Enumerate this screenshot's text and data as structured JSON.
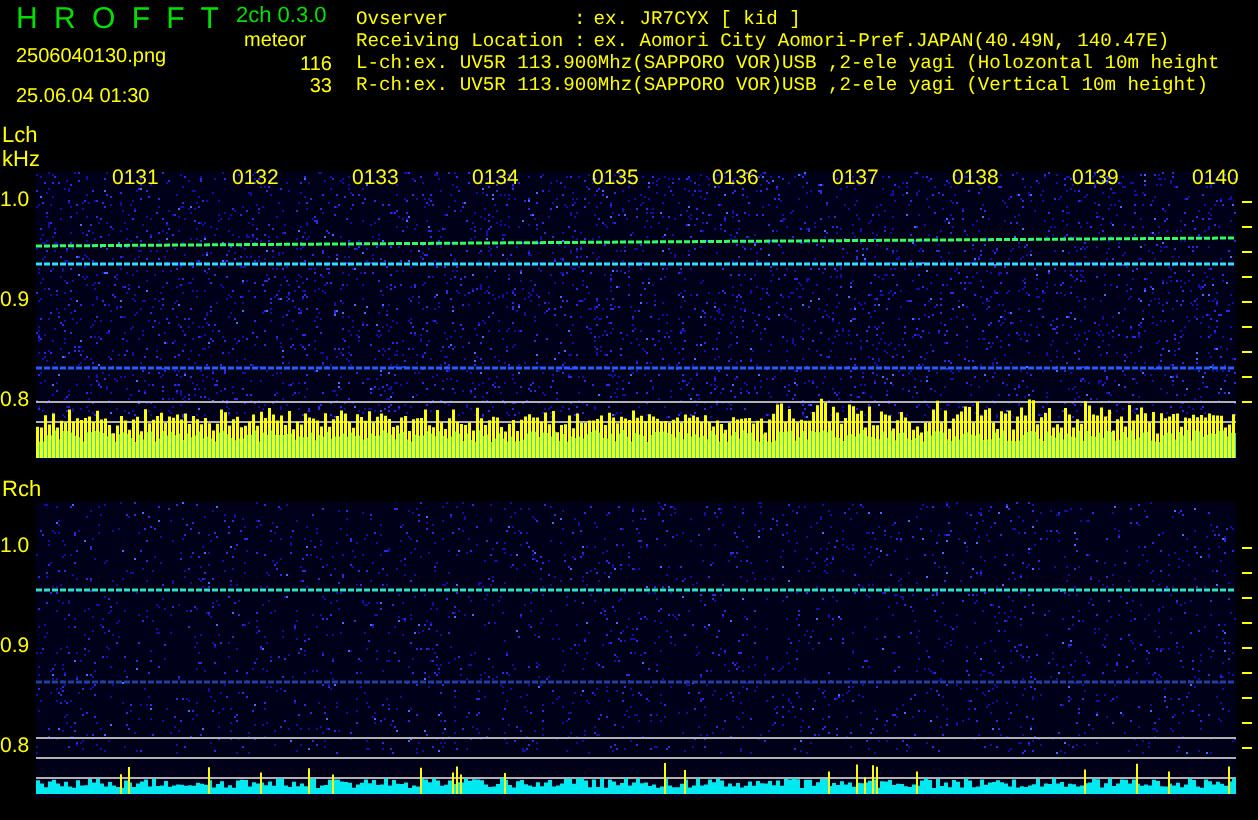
{
  "app": {
    "title": "H R O F F T",
    "version": "2ch 0.3.0",
    "filename": "2506040130.png",
    "datetime": "25.06.04 01:30"
  },
  "meteor": {
    "label": "meteor",
    "counts": [
      "116",
      "33"
    ]
  },
  "info_rows": [
    {
      "kind": "field",
      "label": "Ovserver",
      "separator": ":",
      "value": "ex. JR7CYX [ kid ]"
    },
    {
      "kind": "field",
      "label": "Receiving Location",
      "separator": ":",
      "value": "ex. Aomori City Aomori-Pref.JAPAN(40.49N, 140.47E)"
    },
    {
      "kind": "line",
      "text": "L-ch:ex. UV5R 113.900Mhz(SAPPORO VOR)USB ,2-ele yagi (Holozontal 10m height"
    },
    {
      "kind": "line",
      "text": "R-ch:ex. UV5R 113.900Mhz(SAPPORO VOR)USB ,2-ele yagi (Vertical 10m height)"
    }
  ],
  "panels": [
    {
      "label": "Lch",
      "unit": "kHz",
      "time_labels": [
        "0131",
        "0132",
        "0133",
        "0134",
        "0135",
        "0136",
        "0137",
        "0138",
        "0139",
        "0140"
      ],
      "freq_labels": [
        "1.0",
        "0.9",
        "0.8"
      ]
    },
    {
      "label": "Rch",
      "freq_labels": [
        "1.0",
        "0.9",
        "0.8"
      ]
    }
  ]
}
